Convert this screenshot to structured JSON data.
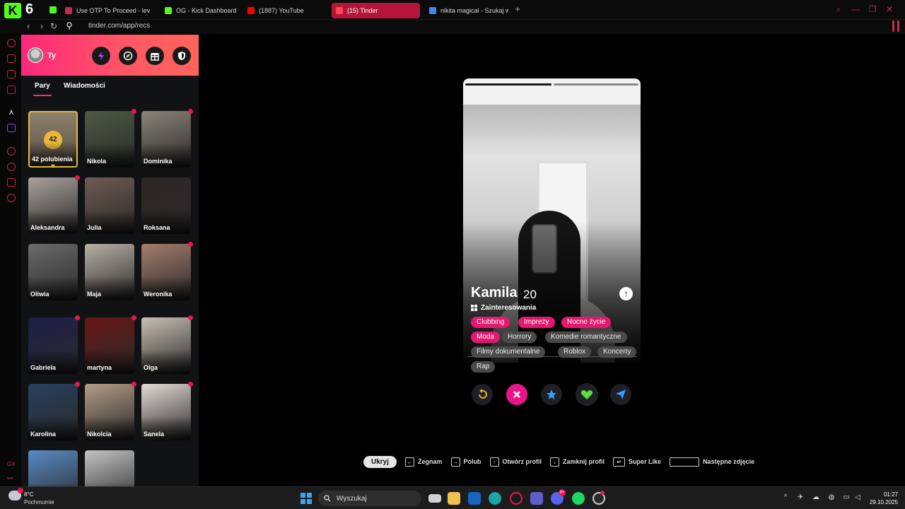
{
  "browser": {
    "tab_counter": "6",
    "tabs": [
      {
        "title": "Use OTP To Proceed - lev",
        "favicon_color": "#c62a4d"
      },
      {
        "title": "OG - Kick Dashboard",
        "favicon_color": "#53fc18"
      },
      {
        "title": "(1887) YouTube",
        "favicon_color": "#ff0000"
      },
      {
        "title": "(15) Tinder",
        "favicon_color": "#ff4458",
        "active": true
      },
      {
        "title": "nikita magical - Szukaj w",
        "favicon_color": "#4285f4"
      }
    ],
    "url": "tinder.com/app/recs",
    "accent": "#c62a4d"
  },
  "sidebar": {
    "user_name": "Ty",
    "header_buttons": [
      "boost-icon",
      "explore-icon",
      "gift-icon",
      "shield-icon"
    ],
    "tabs": [
      {
        "label": "Pary",
        "active": true
      },
      {
        "label": "Wiadomości",
        "active": false
      }
    ],
    "likes": {
      "count": "42",
      "label": "42 polubienia"
    },
    "matches": [
      {
        "name": "Nikola",
        "new": true,
        "tone": "#4c5a44"
      },
      {
        "name": "Dominika",
        "new": true,
        "tone": "#8b8378"
      },
      {
        "name": "Aleksandra",
        "new": true,
        "tone": "#a8a29a"
      },
      {
        "name": "Julia",
        "new": false,
        "tone": "#6e5b52"
      },
      {
        "name": "Roksana",
        "new": false,
        "tone": "#2c2624"
      },
      {
        "name": "Oliwia",
        "new": false,
        "tone": "#6b6b6b"
      },
      {
        "name": "Maja",
        "new": false,
        "tone": "#b7b0a6"
      },
      {
        "name": "Weronika",
        "new": true,
        "tone": "#a47d6c"
      },
      {
        "name": "Gabriela",
        "new": true,
        "tone": "#1d1f4a"
      },
      {
        "name": "martyna",
        "new": true,
        "tone": "#6a1616"
      },
      {
        "name": "Olga",
        "new": true,
        "tone": "#c9bfb3"
      },
      {
        "name": "Karolina",
        "new": true,
        "tone": "#27405e"
      },
      {
        "name": "Nikolcia",
        "new": true,
        "tone": "#b39c86"
      },
      {
        "name": "Sanela",
        "new": true,
        "tone": "#e5dad5"
      },
      {
        "name": "",
        "new": false,
        "tone": "#5a8ac4"
      },
      {
        "name": "",
        "new": false,
        "tone": "#c4c4c4"
      }
    ]
  },
  "profile": {
    "name": "Kamila",
    "age": "20",
    "section_title": "Zainteresowania",
    "interests": [
      {
        "label": "Clubbing",
        "highlight": true
      },
      {
        "label": "Imprezy",
        "highlight": true
      },
      {
        "label": "Nocne życie",
        "highlight": true
      },
      {
        "label": "Moda",
        "highlight": true
      },
      {
        "label": "Horrory",
        "highlight": false
      },
      {
        "label": "Komedie romantyczne",
        "highlight": false
      },
      {
        "label": "Filmy dokumentalne",
        "highlight": false
      },
      {
        "label": "Roblox",
        "highlight": false
      },
      {
        "label": "Koncerty",
        "highlight": false
      },
      {
        "label": "Rap",
        "highlight": false
      }
    ],
    "photo_count": 2,
    "current_photo": 1,
    "actions": [
      "rewind-icon",
      "nope-icon",
      "super-like-icon",
      "like-icon",
      "boost-send-icon"
    ]
  },
  "shortcuts": {
    "hide_label": "Ukryj",
    "items": [
      {
        "key": "←",
        "label": "Żegnam"
      },
      {
        "key": "→",
        "label": "Polub"
      },
      {
        "key": "↑",
        "label": "Otwórz profil"
      },
      {
        "key": "↓",
        "label": "Zamknij profil"
      },
      {
        "key": "↵",
        "label": "Super Like"
      },
      {
        "key": "",
        "label": "Następne zdjęcie"
      }
    ]
  },
  "taskbar": {
    "weather_temp": "8°C",
    "weather_cond": "Pochmurnie",
    "search_placeholder": "Wyszukaj",
    "time": "01:27",
    "date": "29.10.2025",
    "discord_badge": "9+"
  }
}
